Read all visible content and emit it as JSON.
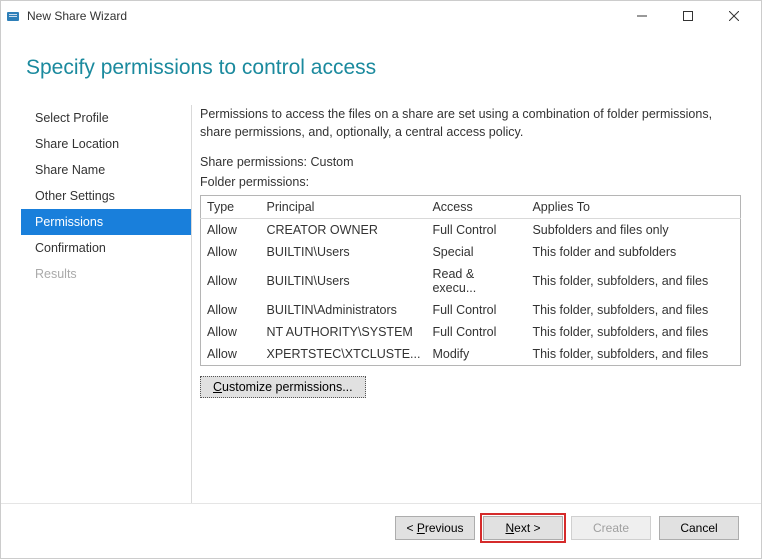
{
  "window": {
    "title": "New Share Wizard"
  },
  "heading": "Specify permissions to control access",
  "sidebar": {
    "items": [
      {
        "label": "Select Profile",
        "state": "normal"
      },
      {
        "label": "Share Location",
        "state": "normal"
      },
      {
        "label": "Share Name",
        "state": "normal"
      },
      {
        "label": "Other Settings",
        "state": "normal"
      },
      {
        "label": "Permissions",
        "state": "active"
      },
      {
        "label": "Confirmation",
        "state": "normal"
      },
      {
        "label": "Results",
        "state": "disabled"
      }
    ]
  },
  "panel": {
    "intro": "Permissions to access the files on a share are set using a combination of folder permissions, share permissions, and, optionally, a central access policy.",
    "share_permissions_label": "Share permissions: ",
    "share_permissions_value": "Custom",
    "folder_permissions_label": "Folder permissions:",
    "table": {
      "headers": {
        "type": "Type",
        "principal": "Principal",
        "access": "Access",
        "applies": "Applies To"
      },
      "rows": [
        {
          "type": "Allow",
          "principal": "CREATOR OWNER",
          "access": "Full Control",
          "applies": "Subfolders and files only"
        },
        {
          "type": "Allow",
          "principal": "BUILTIN\\Users",
          "access": "Special",
          "applies": "This folder and subfolders"
        },
        {
          "type": "Allow",
          "principal": "BUILTIN\\Users",
          "access": "Read & execu...",
          "applies": "This folder, subfolders, and files"
        },
        {
          "type": "Allow",
          "principal": "BUILTIN\\Administrators",
          "access": "Full Control",
          "applies": "This folder, subfolders, and files"
        },
        {
          "type": "Allow",
          "principal": "NT AUTHORITY\\SYSTEM",
          "access": "Full Control",
          "applies": "This folder, subfolders, and files"
        },
        {
          "type": "Allow",
          "principal": "XPERTSTEC\\XTCLUSTE...",
          "access": "Modify",
          "applies": "This folder, subfolders, and files"
        }
      ]
    },
    "customize_btn": "Customize permissions..."
  },
  "footer": {
    "previous": "< Previous",
    "next": "Next >",
    "create": "Create",
    "cancel": "Cancel"
  }
}
